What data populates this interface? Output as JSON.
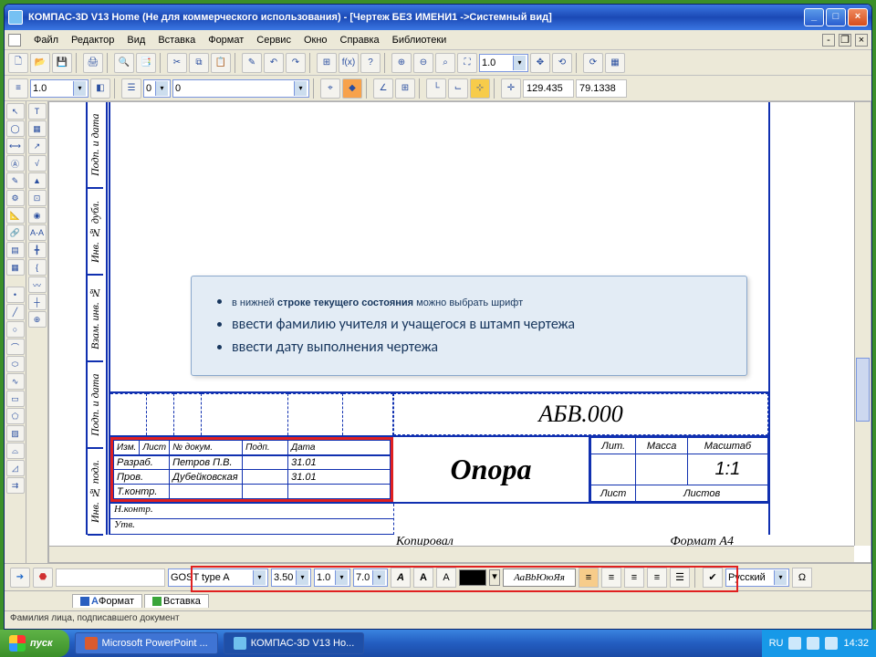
{
  "title": "КОМПАС-3D V13 Home (Не для коммерческого использования) - [Чертеж БЕЗ ИМЕНИ1 ->Системный вид]",
  "menu": {
    "file": "Файл",
    "edit": "Редактор",
    "view": "Вид",
    "insert": "Вставка",
    "format": "Формат",
    "service": "Сервис",
    "window": "Окно",
    "help": "Справка",
    "libs": "Библиотеки"
  },
  "tb1": {
    "scale": "1.0",
    "layer_num": "0",
    "layer_name": "0",
    "zoom": "1.0",
    "coord_x": "129.435",
    "coord_y": "79.1338"
  },
  "sidecol": [
    "Подп. и дата",
    "Инв. № дубл.",
    "Взам. инв. №",
    "Подп. и дата",
    "Инв. № подл."
  ],
  "callout": {
    "l1a": "в нижней ",
    "l1b": "строке текущего состояния",
    "l1c": " можно выбрать шрифт",
    "l2": "ввести фамилию учителя и учащегося в штамп чертежа",
    "l3": "ввести дату выполнения чертежа"
  },
  "stamp": {
    "code": "АБВ.000",
    "hdr": {
      "c1": "Изм.",
      "c2": "Лист",
      "c3": "№ докум.",
      "c4": "Подп.",
      "c5": "Дата"
    },
    "r1": {
      "role": "Разраб.",
      "name": "Петров П.В.",
      "date": "31.01"
    },
    "r2": {
      "role": "Пров.",
      "name": "Дубейковская",
      "date": "31.01"
    },
    "r3": {
      "role": "Т.контр."
    },
    "name": "Опора",
    "right": {
      "lit": "Лит.",
      "mass": "Масса",
      "scale": "Масштаб",
      "scale_val": "1:1",
      "sheet": "Лист",
      "sheets": "Листов"
    },
    "f1": "Н.контр.",
    "f2": "Утв.",
    "cap1": "Копировал",
    "cap2": "Формат   А4"
  },
  "fontbar": {
    "font": "GOST type A",
    "size": "3.50",
    "step": "1.0",
    "h": "7.0",
    "preview": "АаВbЮюЯя",
    "lang": "Русский"
  },
  "tabs": {
    "t1": "Формат",
    "t2": "Вставка"
  },
  "status": "Фамилия лица, подписавшего документ",
  "taskbar": {
    "start": "пуск",
    "t1": "Microsoft PowerPoint ...",
    "t2": "КОМПАС-3D V13 Ho...",
    "lang": "RU",
    "time": "14:32"
  }
}
